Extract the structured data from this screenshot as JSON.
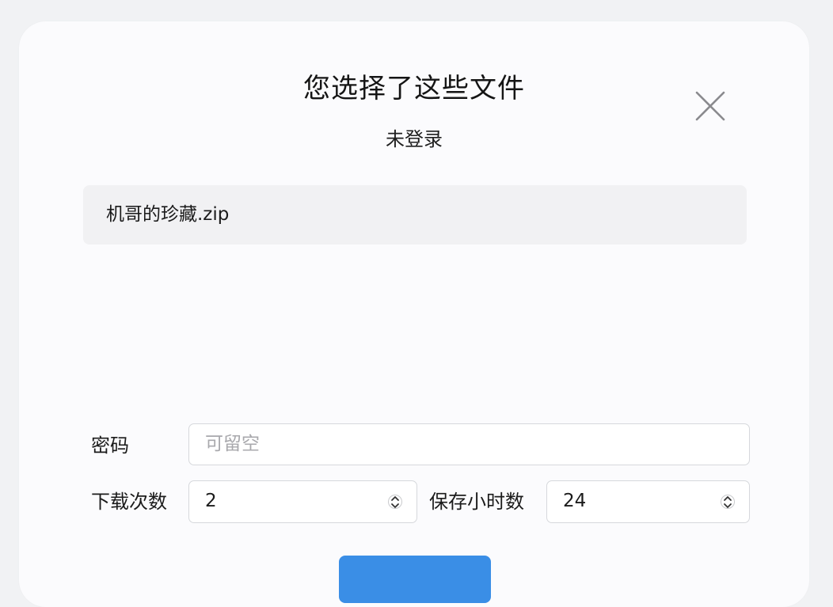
{
  "dialog": {
    "title": "您选择了这些文件",
    "subtitle": "未登录",
    "close_icon": "close-icon"
  },
  "files": [
    {
      "name": "机哥的珍藏.zip"
    }
  ],
  "form": {
    "password_label": "密码",
    "password_placeholder": "可留空",
    "password_value": "",
    "download_count_label": "下载次数",
    "download_count_value": "2",
    "save_hours_label": "保存小时数",
    "save_hours_value": "24"
  },
  "colors": {
    "accent": "#3a8ee6",
    "file_row_bg": "#f1f1f3",
    "dialog_bg": "#fbfbfd"
  }
}
